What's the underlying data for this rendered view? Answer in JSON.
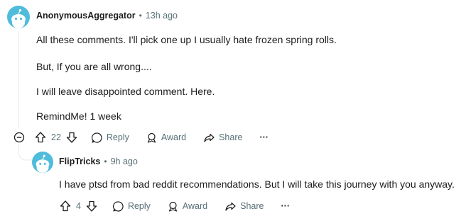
{
  "comments": [
    {
      "username": "AnonymousAggregator",
      "time": "13h ago",
      "paragraphs": [
        "All these comments. I'll pick one up I usually hate frozen spring rolls.",
        "But, If you are all wrong....",
        "I will leave disappointed comment. Here.",
        "RemindMe! 1 week"
      ],
      "score": "22",
      "actions": {
        "reply": "Reply",
        "award": "Award",
        "share": "Share",
        "more": "···"
      }
    },
    {
      "username": "FlipTricks",
      "time": "9h ago",
      "paragraphs": [
        "I have ptsd from bad reddit recommendations. But I will take this journey with you anyway."
      ],
      "score": "4",
      "actions": {
        "reply": "Reply",
        "award": "Award",
        "share": "Share",
        "more": "···"
      }
    }
  ],
  "separator": "•",
  "colors": {
    "avatar": "#4fbcdc",
    "meta": "#576f76",
    "thread_line": "#e5ebee"
  }
}
